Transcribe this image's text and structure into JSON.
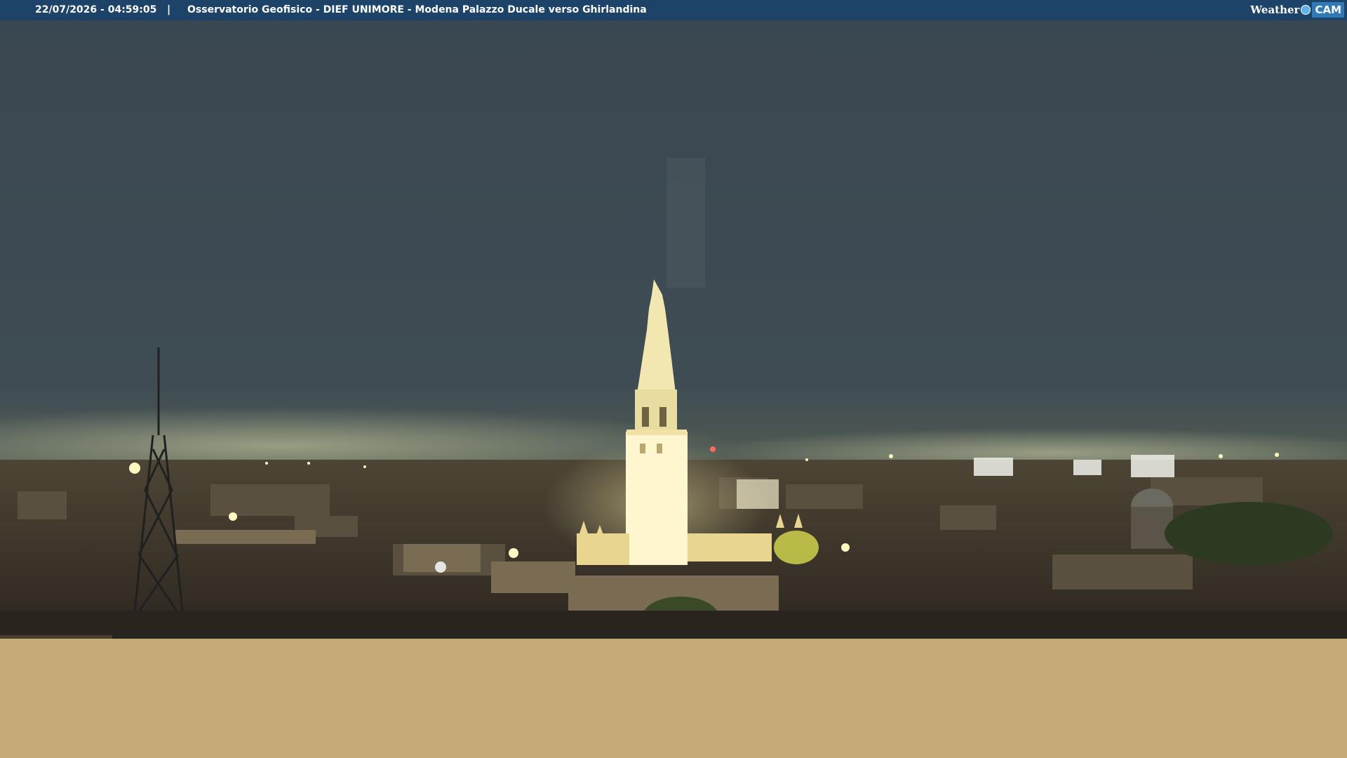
{
  "overlay": {
    "timestamp": "22/07/2026 - 04:59:05",
    "separator": "|",
    "caption": "Osservatorio Geofisico - DIEF UNIMORE - Modena Palazzo Ducale verso Ghirlandina",
    "logo_weather": "Weather",
    "logo_cam": "CAM"
  },
  "scene": {
    "subject": "Ghirlandina tower at night",
    "sky_color": "#3b4a55",
    "haze_color": "#c9caa6",
    "tower_color": "#fff6c8",
    "city_color": "#3a332a",
    "panel_color": "#c6aa77",
    "bar_color": "#1d4468"
  }
}
